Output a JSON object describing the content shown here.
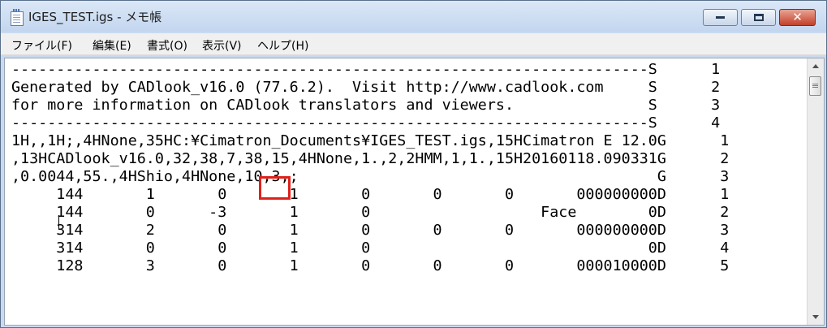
{
  "window": {
    "title": "IGES_TEST.igs - メモ帳",
    "icon": "notepad-icon",
    "buttons": {
      "minimize": "minimize-icon",
      "maximize": "maximize-icon",
      "close": "✕"
    }
  },
  "menu": [
    "ファイル(F)",
    "編集(E)",
    "書式(O)",
    "表示(V)",
    "ヘルプ(H)"
  ],
  "lines": [
    {
      "text": "-----------------------------------------------------------------------",
      "seq": "S      1"
    },
    {
      "text": "Generated by CADlook_v16.0 (77.6.2).  Visit http://www.cadlook.com     ",
      "seq": "S      2"
    },
    {
      "text": "for more information on CADlook translators and viewers.               ",
      "seq": "S      3"
    },
    {
      "text": "-----------------------------------------------------------------------",
      "seq": "S      4"
    },
    {
      "text": "1H,,1H;,4HNone,35HC:¥Cimatron_Documents¥IGES_TEST.igs,15HCimatron E 12.0",
      "seq": "G      1"
    },
    {
      "text": ",13HCADlook_v16.0,32,38,7,38,15,4HNone,1.,2,2HMM,1,1.,15H20160118.090331",
      "seq": "G      2"
    },
    {
      "text": ",0.0044,55.,4HShio,4HNone,10,3,;                                        ",
      "seq": "G      3"
    },
    {
      "text": "     144       1       0       1       0       0       0       000000000",
      "seq": "D      1"
    },
    {
      "text": "     144       0      -3       1       0                   Face        0",
      "seq": "D      2"
    },
    {
      "text": "     314       2       0       1       0       0       0       000000000",
      "seq": "D      3"
    },
    {
      "text": "     314       0       0       1       0                               0",
      "seq": "D      4"
    },
    {
      "text": "     128       3       0       1       0       0       0       000010000",
      "seq": "D      5"
    }
  ],
  "highlight": {
    "value": "10,",
    "color": "#e0201a"
  },
  "scrollbar": {
    "up": "scroll-up-arrow-icon",
    "down": "scroll-down-arrow-icon"
  }
}
